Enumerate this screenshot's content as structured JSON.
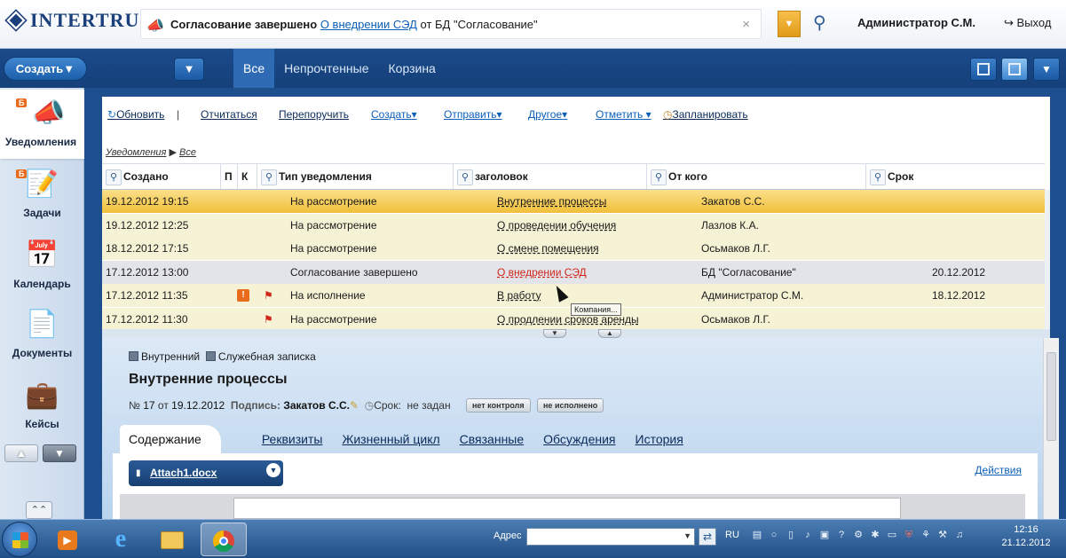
{
  "header": {
    "logo": "InterTrust",
    "notification": {
      "status": "Согласование завершено",
      "link": "О внедрении СЭД",
      "from": "от БД \"Согласование\""
    },
    "user": "Администратор С.М.",
    "exit_label": "Выход"
  },
  "nav": {
    "create_label": "Создать",
    "tabs": [
      {
        "label": "Все",
        "active": true
      },
      {
        "label": "Непрочтенные",
        "active": false
      },
      {
        "label": "Корзина",
        "active": false
      }
    ]
  },
  "sidebar": {
    "items": [
      {
        "label": "Уведомления",
        "icon": "megaphone-icon",
        "badge": "Б",
        "active": true
      },
      {
        "label": "Задачи",
        "icon": "notepad-icon",
        "badge": "Б",
        "active": false
      },
      {
        "label": "Календарь",
        "icon": "calendar-icon",
        "badge": "",
        "active": false
      },
      {
        "label": "Документы",
        "icon": "documents-icon",
        "badge": "",
        "active": false
      },
      {
        "label": "Кейсы",
        "icon": "briefcase-icon",
        "badge": "",
        "active": false
      }
    ]
  },
  "toolbar": {
    "refresh": "Обновить",
    "report": "Отчитаться",
    "reassign": "Перепоручить",
    "create": "Создать",
    "send": "Отправить",
    "other": "Другое",
    "mark": "Отметить",
    "schedule": "Запланировать"
  },
  "breadcrumb": {
    "section": "Уведомления",
    "current": "Все"
  },
  "grid": {
    "columns": [
      "Создано",
      "П",
      "К",
      "Тип уведомления",
      "заголовок",
      "От кого",
      "Срок"
    ],
    "rows": [
      {
        "created": "19.12.2012 19:15",
        "p": "",
        "k": "",
        "type": "На рассмотрение",
        "subject": "Внутренние процессы",
        "from": "Закатов С.С.",
        "due": "",
        "state": "highlight"
      },
      {
        "created": "19.12.2012 12:25",
        "p": "",
        "k": "",
        "type": "На рассмотрение",
        "subject": "О проведении обучения",
        "from": "Лазлов К.А.",
        "due": "",
        "state": "normal"
      },
      {
        "created": "18.12.2012 17:15",
        "p": "",
        "k": "",
        "type": "На рассмотрение",
        "subject": "О смене помещения",
        "from": "Осьмаков Л.Г.",
        "due": "",
        "state": "normal"
      },
      {
        "created": "17.12.2012 13:00",
        "p": "",
        "k": "",
        "type": "Согласование завершено",
        "subject": "О внедрении СЭД",
        "from": "БД \"Согласование\"",
        "due": "20.12.2012",
        "state": "selected"
      },
      {
        "created": "17.12.2012 11:35",
        "p": "!",
        "k": "flag",
        "type": "На исполнение",
        "subject": "В работу",
        "from": "Администратор С.М.",
        "due": "18.12.2012",
        "state": "normal"
      },
      {
        "created": "17.12.2012 11:30",
        "p": "",
        "k": "flag",
        "type": "На рассмотрение",
        "subject": "О продлении сроков аренды",
        "from": "Осьмаков Л.Г.",
        "due": "",
        "state": "normal"
      }
    ],
    "tooltip": "Компания..."
  },
  "detail": {
    "chip1": "Внутренний",
    "chip2": "Служебная записка",
    "title": "Внутренние процессы",
    "number_prefix": "№",
    "number": "17",
    "date_prefix": "от",
    "date": "19.12.2012",
    "sign_label": "Подпись:",
    "signer": "Закатов С.С.",
    "due_label": "Срок:",
    "due_value": "не задан",
    "pill_control": "нет контроля",
    "pill_status": "не исполнено",
    "tabs": [
      {
        "label": "Содержание",
        "active": true
      },
      {
        "label": "Реквизиты",
        "active": false
      },
      {
        "label": "Жизненный цикл",
        "active": false
      },
      {
        "label": "Связанные",
        "active": false
      },
      {
        "label": "Обсуждения",
        "active": false
      },
      {
        "label": "История",
        "active": false
      }
    ],
    "attachment": "Attach1.docx",
    "actions": "Действия"
  },
  "taskbar": {
    "address_label": "Адрес",
    "lang": "RU",
    "time": "12:16",
    "date": "21.12.2012"
  }
}
